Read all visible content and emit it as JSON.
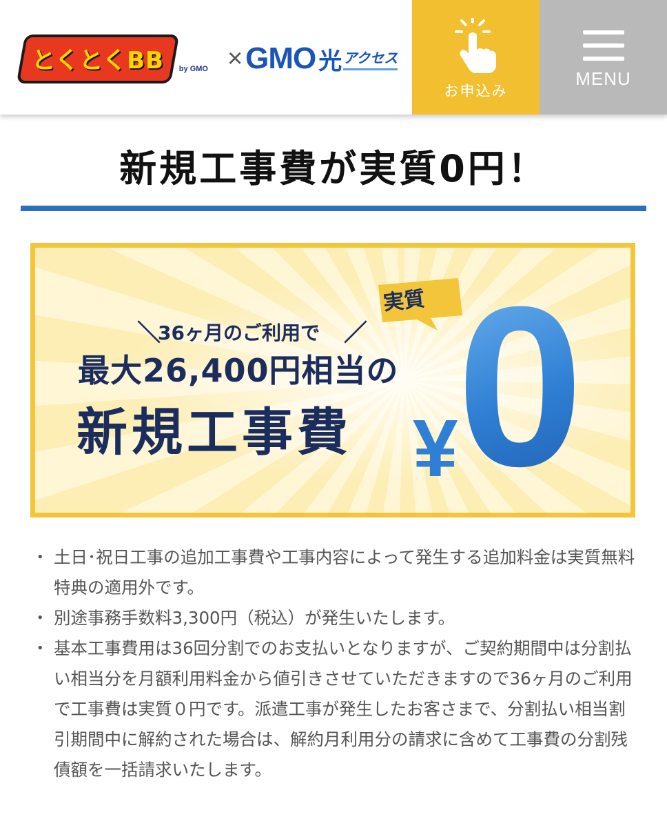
{
  "header": {
    "logo_tokutoku": "とくとくBB",
    "logo_bygmo": "by GMO",
    "logo_times": "×",
    "logo_gmo": "GMO",
    "logo_hikari": "光",
    "logo_access": "アクセス",
    "apply_label": "お申込み",
    "menu_label": "MENU",
    "apply_icon": "tap-hand-icon",
    "menu_icon": "hamburger-icon"
  },
  "page": {
    "title": "新規工事費が実質0円！"
  },
  "banner": {
    "jissitsu": "実質",
    "months": "36ヶ月のご利用で",
    "slash_left": "＼",
    "slash_right": "／",
    "max_line": "最大26,400円相当の",
    "big_line": "新規工事費",
    "yen": "¥",
    "zero": "0"
  },
  "notes": [
    "土日･祝日工事の追加工事費や工事内容によって発生する追加料金は実質無料特典の適用外です。",
    "別途事務手数料3,300円（税込）が発生いたします。",
    "基本工事費用は36回分割でのお支払いとなりますが、ご契約期間中は分割払い相当分を月額利用料金から値引きさせていただきますので36ヶ月のご利用で工事費は実質０円です。派遣工事が発生したお客さまで、分割払い相当割引期間中に解約された場合は、解約月利用分の請求に含めて工事費の分割残債額を一括請求いたします。"
  ],
  "colors": {
    "apply_bg": "#f1bf2f",
    "menu_bg": "#b9b9b9",
    "rule_blue": "#2d6fbd",
    "banner_border": "#f2c53a",
    "navy_text": "#1b2d5c",
    "zero_blue": "#3b86d6"
  }
}
